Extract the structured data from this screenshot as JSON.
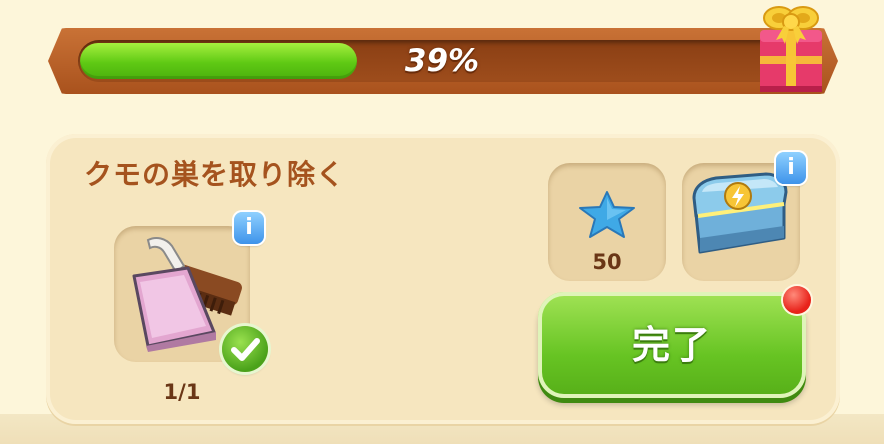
{
  "progress": {
    "percent": 39,
    "label": "39%"
  },
  "quest": {
    "title": "クモの巣を取り除く",
    "item": {
      "icon": "dustpan-brush-icon",
      "count_label": "1/1",
      "completed": true
    },
    "rewards": [
      {
        "icon": "blue-star-icon",
        "amount": "50"
      },
      {
        "icon": "energy-chest-icon"
      }
    ],
    "complete_button_label": "完了"
  },
  "colors": {
    "progress_fill": "#5fc914",
    "frame": "#a9521d",
    "title": "#a5531e",
    "button": "#67c423",
    "info_badge": "#3e93ea",
    "notification": "#e8221a"
  }
}
